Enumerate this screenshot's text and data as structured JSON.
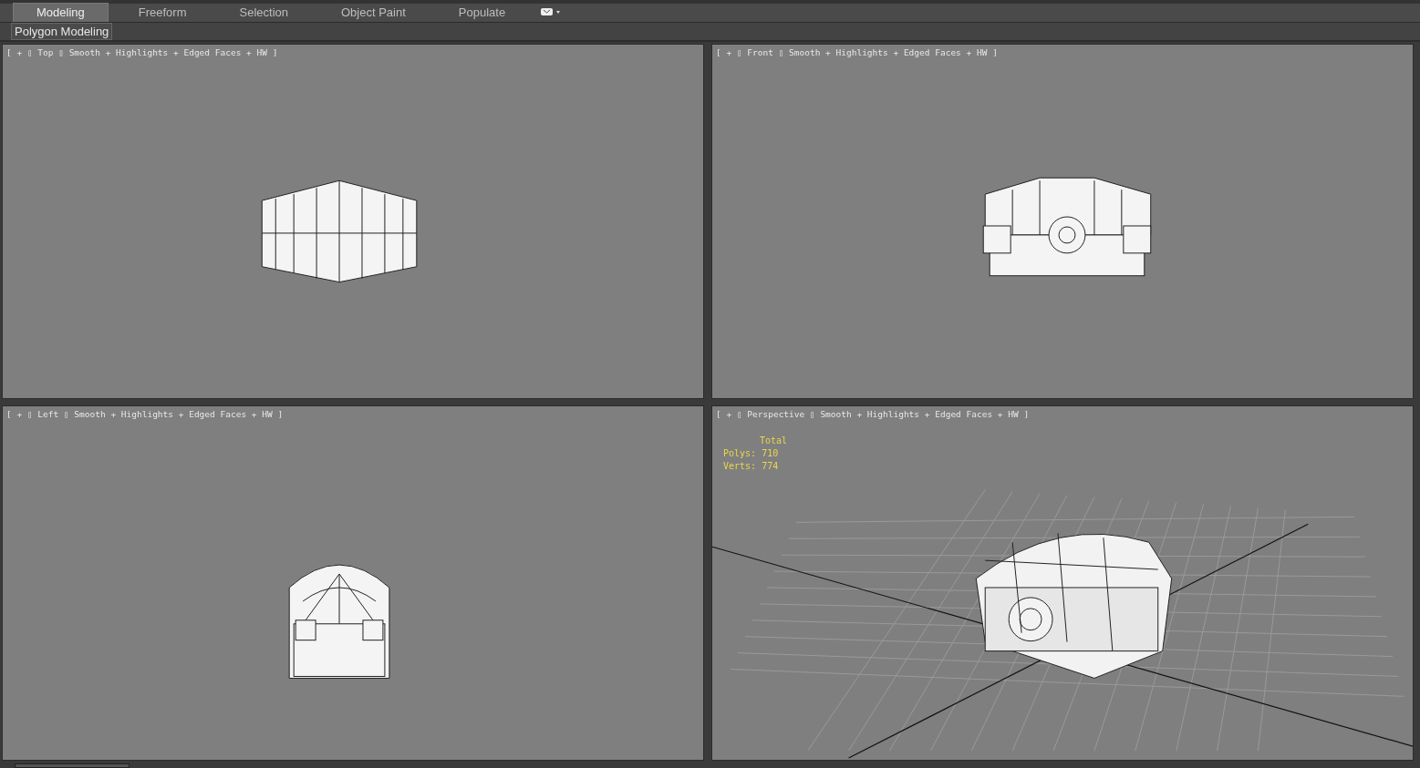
{
  "tabs": [
    {
      "label": "Modeling",
      "selected": true
    },
    {
      "label": "Freeform",
      "selected": false
    },
    {
      "label": "Selection",
      "selected": false
    },
    {
      "label": "Object Paint",
      "selected": false
    },
    {
      "label": "Populate",
      "selected": false
    }
  ],
  "ribbon": {
    "panel": "Polygon Modeling"
  },
  "viewports": [
    {
      "kind": "top",
      "label": "[ + ▯ Top ▯ Smooth + Highlights + Edged Faces + HW ]"
    },
    {
      "kind": "front",
      "label": "[ + ▯ Front ▯ Smooth + Highlights + Edged Faces + HW ]"
    },
    {
      "kind": "left",
      "label": "[ + ▯ Left ▯ Smooth + Highlights + Edged Faces + HW ]"
    },
    {
      "kind": "perspective",
      "label": "[ + ▯ Perspective ▯ Smooth + Highlights + Edged Faces + HW ]",
      "stats": {
        "title": "Total",
        "rows": [
          {
            "label": "Polys:",
            "value": "710"
          },
          {
            "label": "Verts:",
            "value": "774"
          }
        ]
      }
    }
  ]
}
